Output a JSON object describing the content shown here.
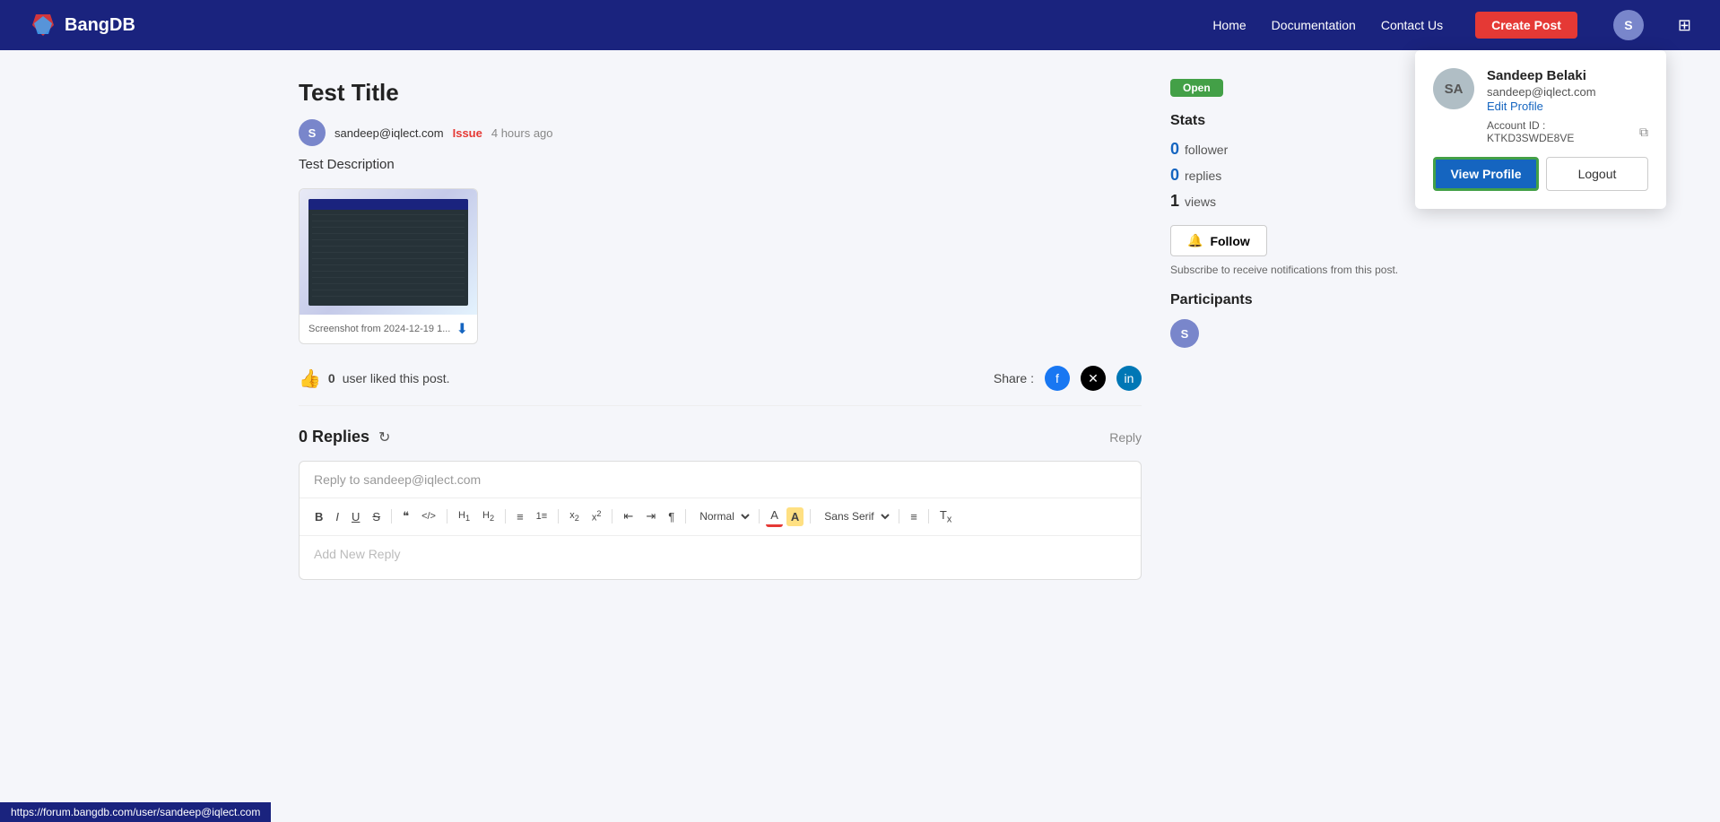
{
  "navbar": {
    "brand": "BangDB",
    "links": [
      {
        "label": "Home",
        "key": "home"
      },
      {
        "label": "Documentation",
        "key": "documentation"
      },
      {
        "label": "Contact Us",
        "key": "contact-us"
      }
    ],
    "create_post_label": "Create Post",
    "avatar_initials": "S",
    "grid_icon": "⊞"
  },
  "dropdown": {
    "avatar_initials": "SA",
    "name": "Sandeep Belaki",
    "email": "sandeep@iqlect.com",
    "edit_profile_label": "Edit Profile",
    "account_id_label": "Account ID : KTKD3SWDE8VE",
    "copy_icon": "⧉",
    "view_profile_label": "View Profile",
    "logout_label": "Logout"
  },
  "post": {
    "title": "Test Title",
    "author_initials": "S",
    "author_email": "sandeep@iqlect.com",
    "tag": "Issue",
    "time": "4 hours ago",
    "description": "Test Description",
    "attachment_name": "Screenshot from 2024-12-19 1...",
    "like_count": "0",
    "like_text": "user liked this post.",
    "share_label": "Share :"
  },
  "replies": {
    "count_label": "0 Replies",
    "reply_link_label": "Reply",
    "reply_placeholder": "Reply to sandeep@iqlect.com",
    "reply_area_placeholder": "Add New Reply",
    "toolbar": {
      "bold": "B",
      "italic": "I",
      "underline": "U",
      "strikethrough": "S",
      "blockquote": "❝",
      "code": "</>",
      "h1": "H₁",
      "h2": "H₂",
      "ul": "≡",
      "ol": "1≡",
      "sub": "x₂",
      "sup": "x²",
      "indent_left": "⇤",
      "indent_right": "⇥",
      "rtl": "¶",
      "format": "Normal",
      "text_color": "A",
      "bg_color": "A",
      "font": "Sans Serif",
      "align": "≡",
      "clear": "Tx"
    }
  },
  "sidebar": {
    "status_badge": "Open",
    "stats_title": "Stats",
    "follower_count": "0",
    "follower_label": "follower",
    "replies_count": "0",
    "replies_label": "replies",
    "views_count": "1",
    "views_label": "views",
    "follow_label": "Follow",
    "follow_icon": "🔔",
    "subscribe_text": "Subscribe to receive notifications from this post.",
    "participants_title": "Participants",
    "participant_initials": "S"
  },
  "status_bar": {
    "url": "https://forum.bangdb.com/user/sandeep@iqlect.com"
  }
}
